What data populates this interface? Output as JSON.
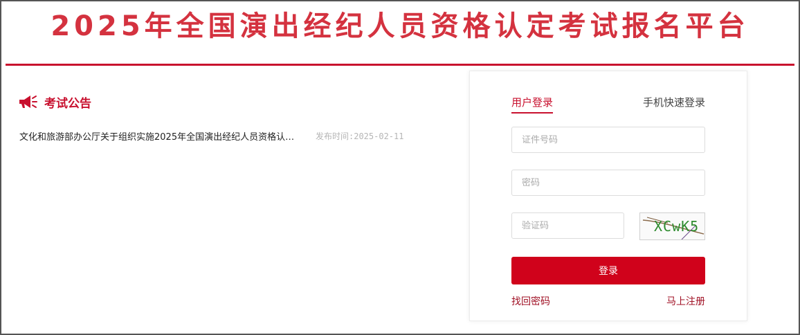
{
  "header": {
    "title": "2025年全国演出经纪人员资格认定考试报名平台"
  },
  "notice": {
    "icon": "megaphone-icon",
    "title": "考试公告",
    "items": [
      {
        "title": "文化和旅游部办公厅关于组织实施2025年全国演出经纪人员资格认…",
        "date": "发布时间:2025-02-11"
      }
    ]
  },
  "login": {
    "tabs": {
      "user": "用户登录",
      "phone": "手机快速登录"
    },
    "id_placeholder": "证件号码",
    "password_placeholder": "密码",
    "captcha_placeholder": "验证码",
    "captcha_text": "XCwK5",
    "submit": "登录",
    "forgot": "找回密码",
    "register": "马上注册"
  },
  "colors": {
    "brand": "#c8102e",
    "button": "#d0021b"
  }
}
